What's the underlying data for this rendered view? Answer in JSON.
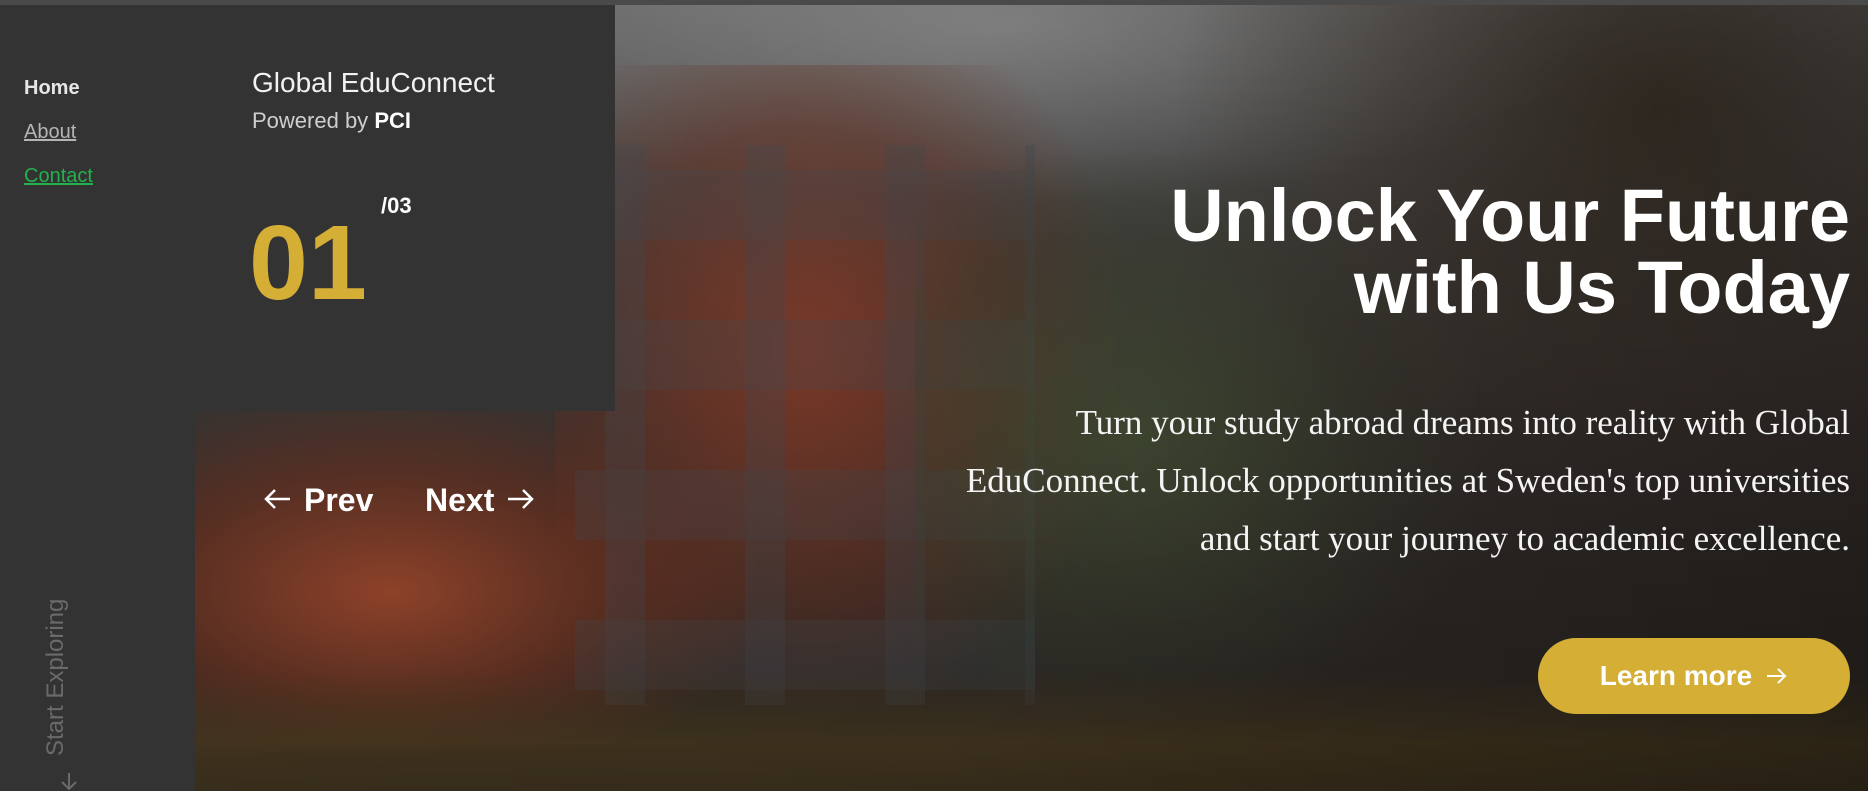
{
  "nav": {
    "items": [
      {
        "label": "Home"
      },
      {
        "label": "About"
      },
      {
        "label": "Contact"
      }
    ]
  },
  "brand": {
    "title": "Global EduConnect",
    "powered_prefix": "Powered by",
    "powered_name": "PCI"
  },
  "slider": {
    "current": "01",
    "total": "/03",
    "prev_label": "Prev",
    "next_label": "Next"
  },
  "hero": {
    "headline_line1": "Unlock Your Future",
    "headline_line2": "with Us Today",
    "subcopy": "Turn your study abroad dreams into reality with Global EduConnect. Unlock opportunities at Sweden's top universities and start your journey to academic excellence.",
    "cta_label": "Learn more"
  },
  "side": {
    "start_exploring": "Start Exploring"
  },
  "colors": {
    "accent": "#d4ae35",
    "panel": "#333333",
    "contact_link": "#22b24c"
  },
  "icons": [
    "arrow-left-icon",
    "arrow-right-icon",
    "arrow-down-icon"
  ]
}
